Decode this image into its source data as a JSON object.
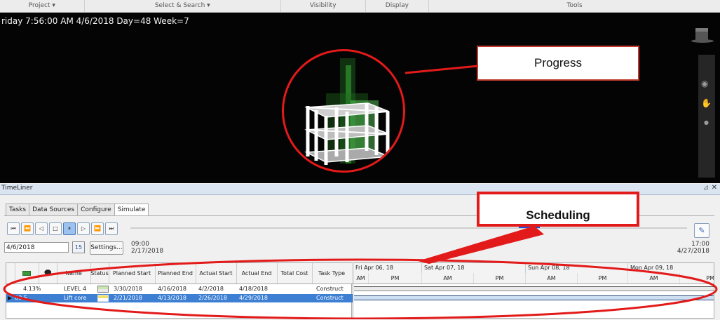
{
  "ribbon": {
    "groups": [
      "Project ▾",
      "Select & Search ▾",
      "Visibility",
      "Display",
      "Tools"
    ]
  },
  "viewport": {
    "status_text": "riday 7:56:00 AM 4/6/2018 Day=48 Week=7",
    "callout_label": "Progress"
  },
  "timeliner": {
    "title": "TimeLiner",
    "pin_icon": "⊿",
    "close_icon": "✕",
    "tabs": [
      {
        "label": "Tasks",
        "active": false
      },
      {
        "label": "Data Sources",
        "active": false
      },
      {
        "label": "Configure",
        "active": false
      },
      {
        "label": "Simulate",
        "active": true
      }
    ],
    "playback": {
      "buttons": [
        "⏮",
        "⏪",
        "◁",
        "□",
        "⏸",
        "▷",
        "⏩",
        "⏭"
      ],
      "active_index": 4
    },
    "current_date": "4/6/2018",
    "calendar_icon_text": "15",
    "settings_label": "Settings...",
    "start_time": "09:00",
    "start_date": "2/17/2018",
    "end_time": "17:00",
    "end_date": "4/27/2018",
    "columns": [
      "",
      "",
      "Name",
      "Status",
      "Planned Start",
      "Planned End",
      "Actual Start",
      "Actual End",
      "Total Cost",
      "Task Type"
    ],
    "rows": [
      {
        "pct": "4.13%",
        "name": "LEVEL 4",
        "planned_start": "3/30/2018",
        "planned_end": "4/16/2018",
        "actual_start": "4/2/2018",
        "actual_end": "4/18/2018",
        "total_cost": "",
        "task_type": "Construct",
        "selected": false
      },
      {
        "pct": "89.5",
        "name": "Lift core",
        "planned_start": "2/21/2018",
        "planned_end": "4/13/2018",
        "actual_start": "2/26/2018",
        "actual_end": "4/29/2018",
        "total_cost": "",
        "task_type": "Construct",
        "selected": true
      }
    ],
    "gantt": {
      "days": [
        "Fri Apr 06, 18",
        "Sat Apr 07, 18",
        "Sun Apr 08, 18",
        "Mon Apr 09, 18"
      ],
      "halves": [
        "AM",
        "PM",
        "AM",
        "PM",
        "AM",
        "PM",
        "AM",
        "PM"
      ]
    },
    "callout_label": "Scheduling"
  },
  "colors": {
    "annotation_red": "#e31a1a",
    "selection_blue": "#3d7fd3",
    "slider_blue": "#1f4fd8"
  }
}
